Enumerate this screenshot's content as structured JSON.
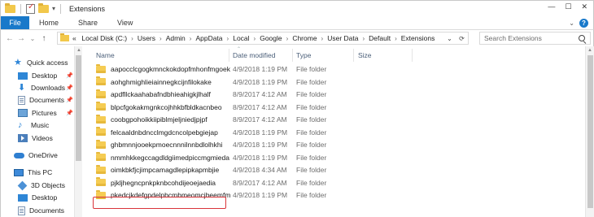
{
  "window": {
    "title": "Extensions"
  },
  "ribbon": {
    "file_label": "File",
    "tabs": [
      {
        "label": "Home"
      },
      {
        "label": "Share"
      },
      {
        "label": "View"
      }
    ],
    "expand_glyph": "⌄",
    "help_glyph": "?"
  },
  "nav_buttons": {
    "back": "←",
    "forward": "→",
    "recent": "⌄",
    "up": "↑"
  },
  "address": {
    "prefix": "«",
    "crumbs": [
      {
        "label": "Local Disk (C:)"
      },
      {
        "label": "Users"
      },
      {
        "label": "Admin"
      },
      {
        "label": "AppData"
      },
      {
        "label": "Local"
      },
      {
        "label": "Google"
      },
      {
        "label": "Chrome"
      },
      {
        "label": "User Data"
      },
      {
        "label": "Default"
      },
      {
        "label": "Extensions"
      }
    ],
    "separator": "›",
    "dropdown_glyph": "⌄",
    "refresh_glyph": "⟳"
  },
  "search": {
    "placeholder": "Search Extensions"
  },
  "nav_pane": {
    "quick_access": "Quick access",
    "items": [
      {
        "label": "Desktop",
        "icon": "desktop-icon",
        "pinned": true
      },
      {
        "label": "Downloads",
        "icon": "downloads-icon",
        "pinned": true
      },
      {
        "label": "Documents",
        "icon": "documents-icon",
        "pinned": true
      },
      {
        "label": "Pictures",
        "icon": "pictures-icon",
        "pinned": true
      },
      {
        "label": "Music",
        "icon": "music-icon",
        "pinned": false
      },
      {
        "label": "Videos",
        "icon": "videos-icon",
        "pinned": false
      }
    ],
    "onedrive": "OneDrive",
    "this_pc": "This PC",
    "pc_items": [
      {
        "label": "3D Objects",
        "icon": "3d-objects-icon"
      },
      {
        "label": "Desktop",
        "icon": "desktop-icon"
      },
      {
        "label": "Documents",
        "icon": "documents-icon"
      }
    ],
    "pin_glyph": "📌"
  },
  "columns": {
    "name": "Name",
    "date": "Date modified",
    "type": "Type",
    "size": "Size"
  },
  "files": [
    {
      "name": "aapocclcgogkmnckokdopfmhonfmgoek",
      "date": "4/9/2018 1:19 PM",
      "type": "File folder"
    },
    {
      "name": "aohghmighlieiainnegkcijnfilokake",
      "date": "4/9/2018 1:19 PM",
      "type": "File folder"
    },
    {
      "name": "apdfllckaahabafndbhieahigkjlhalf",
      "date": "8/9/2017 4:12 AM",
      "type": "File folder"
    },
    {
      "name": "blpcfgokakmgnkcojhhkbfbldkacnbeo",
      "date": "8/9/2017 4:12 AM",
      "type": "File folder"
    },
    {
      "name": "coobgpohoikkiipiblmjeljniedjpjpf",
      "date": "8/9/2017 4:12 AM",
      "type": "File folder"
    },
    {
      "name": "felcaaldnbdncclmgdcncolpebgiejap",
      "date": "4/9/2018 1:19 PM",
      "type": "File folder"
    },
    {
      "name": "ghbmnnjooekpmoecnnnilnnbdlolhkhi",
      "date": "4/9/2018 1:19 PM",
      "type": "File folder"
    },
    {
      "name": "nmmhkkegccagdldgiimedpiccmgmieda",
      "date": "4/9/2018 1:19 PM",
      "type": "File folder"
    },
    {
      "name": "oimkbkfjcjimpcamagdlepipkapmbjie",
      "date": "4/9/2018 4:34 AM",
      "type": "File folder"
    },
    {
      "name": "pjkljhegncpnkpknbcohdijeoejaedia",
      "date": "8/9/2017 4:12 AM",
      "type": "File folder"
    },
    {
      "name": "pkedcjkdefgpdelpbcmbmeomcjbeemfm",
      "date": "4/9/2018 1:19 PM",
      "type": "File folder"
    }
  ],
  "highlighted_file": "oimkbkfjcjimpcamagdlepipkapmbjie",
  "colors": {
    "file_tab": "#1979ca",
    "highlight": "#d9343a",
    "folder": "#f5cc53"
  }
}
